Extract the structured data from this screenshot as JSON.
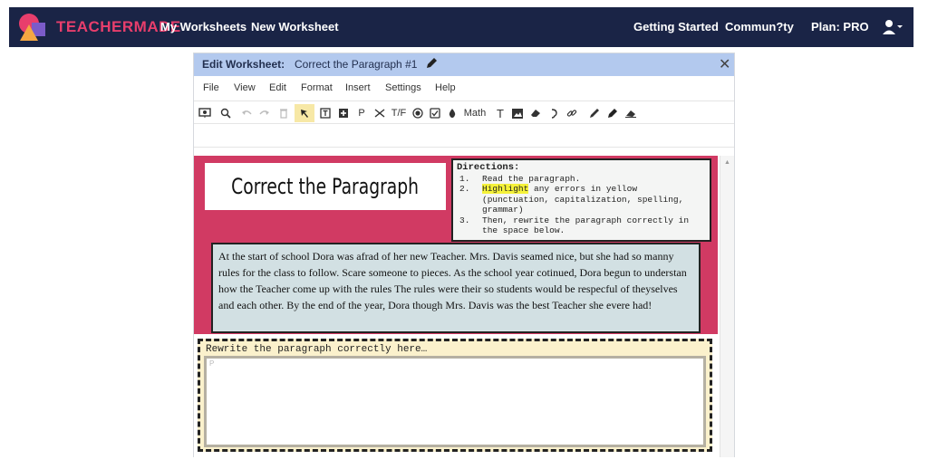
{
  "brand": {
    "name": "TEACHERMADE",
    "color": "#e83e6c",
    "nav_bg": "#1a2446"
  },
  "topnav": {
    "my_worksheets": "My Worksheets",
    "new_worksheet": "New Worksheet",
    "getting_started": "Getting Started",
    "community": "Commun?ty",
    "plan": "Plan: PRO",
    "user_icon": "user-icon"
  },
  "editor": {
    "header_label": "Edit Worksheet:",
    "worksheet_name": "Correct the Paragraph #1",
    "close": "✕",
    "menu": [
      "File",
      "View",
      "Edit",
      "Format",
      "Insert",
      "Settings",
      "Help"
    ],
    "toolbar": {
      "tf_label": "T/F",
      "math_label": "Math",
      "p_label": "P",
      "t_label": "T"
    }
  },
  "worksheet": {
    "title": "Correct the Paragraph",
    "directions": {
      "heading": "Directions:",
      "items": [
        {
          "num": "1.",
          "text": "Read the paragraph."
        },
        {
          "num": "2.",
          "highlight": "Highlight",
          "text": " any errors in yellow (punctuation, capitalization, spelling, grammar)"
        },
        {
          "num": "3.",
          "text": "Then, rewrite the paragraph correctly in the space below."
        }
      ]
    },
    "paragraph": "At the start of  school Dora was afrad of  her new Teacher. Mrs. Davis seamed nice, but she had so manny rules for the class to follow. Scare  someone to pieces. As the school year cotinued, Dora begun to understan how the Teacher come up with the rules The rules were their so students would be respecful of  theyselves and each other. By the end of  the year, Dora though Mrs. Davis was the best Teacher she evere had!",
    "rewrite_label": "Rewrite the paragraph correctly here…",
    "rewrite_placeholder": "P",
    "colors": {
      "background": "#d13a63",
      "paragraph_bg": "#d2e0e3",
      "rewrite_bg": "#fbf1cc",
      "highlight": "#f5f23a"
    }
  }
}
